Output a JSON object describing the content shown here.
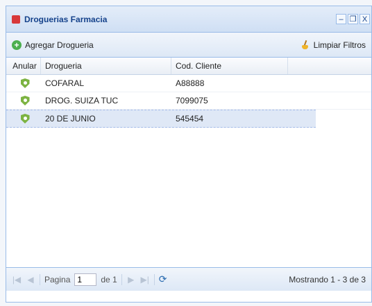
{
  "window": {
    "title": "Droguerias Farmacia",
    "buttons": [
      "–",
      "❐",
      "X"
    ]
  },
  "toolbar": {
    "add_label": "Agregar Drogueria",
    "clear_label": "Limpiar Filtros"
  },
  "grid": {
    "headers": [
      "Anular",
      "Drogueria",
      "Cod. Cliente"
    ],
    "rows": [
      {
        "drogueria": "COFARAL",
        "cod_cliente": "A88888",
        "selected": false
      },
      {
        "drogueria": "DROG. SUIZA TUC",
        "cod_cliente": "7099075",
        "selected": false
      },
      {
        "drogueria": "20 DE JUNIO",
        "cod_cliente": "545454",
        "selected": true
      }
    ]
  },
  "pager": {
    "page_label": "Pagina",
    "page_value": "1",
    "of_label": "de 1",
    "display": "Mostrando 1 - 3 de 3"
  }
}
